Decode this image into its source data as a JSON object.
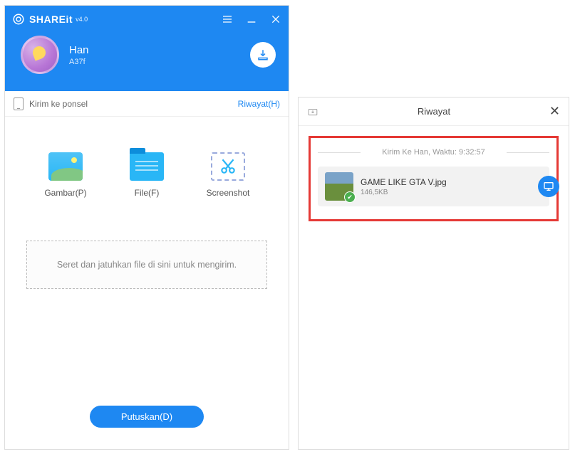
{
  "app": {
    "title": "SHAREit",
    "version": "v4.0"
  },
  "profile": {
    "name": "Han",
    "code": "A37f"
  },
  "subbar": {
    "send_to_phone": "Kirim ke ponsel",
    "history_link": "Riwayat(H)"
  },
  "categories": {
    "image": "Gambar(P)",
    "file": "File(F)",
    "screenshot": "Screenshot"
  },
  "dropzone": "Seret dan jatuhkan file di sini untuk mengirim.",
  "disconnect": "Putuskan(D)",
  "history": {
    "title": "Riwayat",
    "session_label": "Kirim Ke Han, Waktu: 9:32:57",
    "file": {
      "name": "GAME LIKE GTA V.jpg",
      "size": "146,5KB"
    }
  }
}
